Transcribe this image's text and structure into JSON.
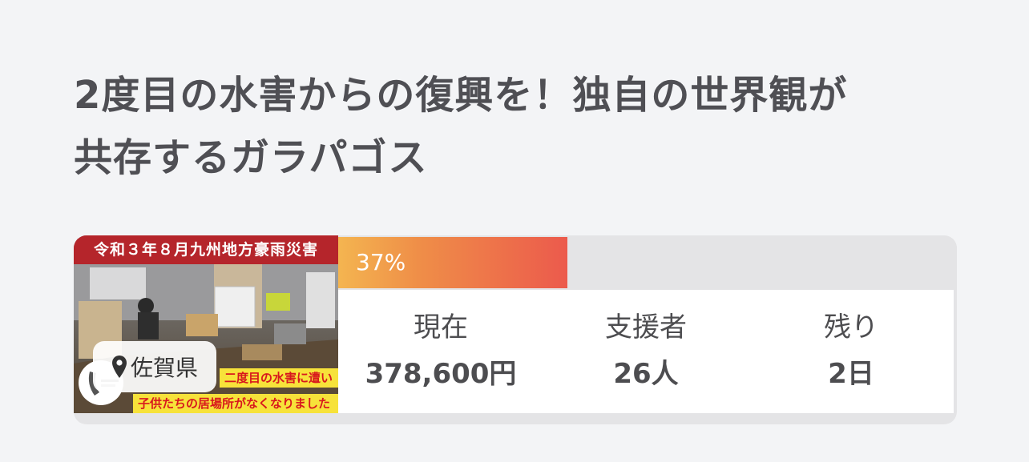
{
  "project": {
    "title_line1": "2度目の水害からの復興を！独自の世界観が",
    "title_line2": "共存するガラパゴス"
  },
  "thumbnail": {
    "banner": "令和３年８月九州地方豪雨災害",
    "caption_line1": "二度目の水害に遭い",
    "caption_line2": "子供たちの居場所がなくなりました"
  },
  "location": {
    "icon": "map-pin-icon",
    "label": "佐賀県"
  },
  "progress": {
    "percent": 37,
    "label": "37%"
  },
  "stats": {
    "current_label": "現在",
    "current_value": "378,600円",
    "supporters_label": "支援者",
    "supporters_value": "26人",
    "remaining_label": "残り",
    "remaining_value": "2日"
  },
  "colors": {
    "progress_start": "#f4b550",
    "progress_end": "#ec5a4c",
    "banner": "#b5252b",
    "caption_bg": "#f7e23a",
    "caption_text": "#d8181d"
  }
}
